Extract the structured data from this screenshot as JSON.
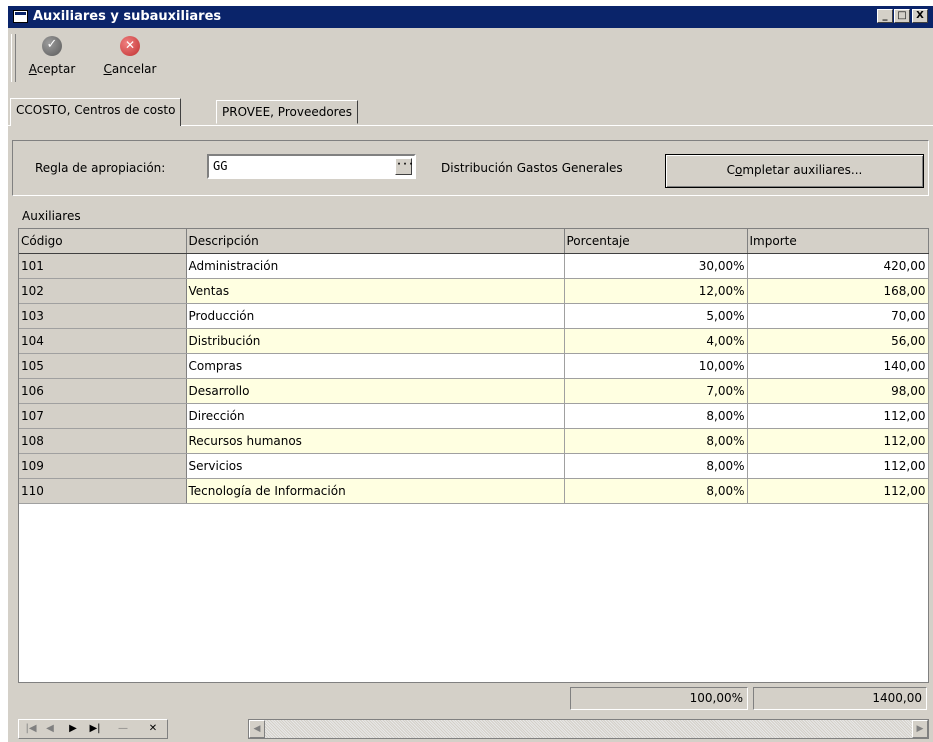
{
  "window": {
    "title": "Auxiliares y subauxiliares",
    "controls": [
      "_",
      "□",
      "X"
    ]
  },
  "toolbar": {
    "aceptar": {
      "prefix": "",
      "accel": "A",
      "rest": "ceptar",
      "icon": "check-circle-icon"
    },
    "cancelar": {
      "prefix": "",
      "accel": "C",
      "rest": "ancelar",
      "icon": "cancel-circle-icon"
    }
  },
  "tabs": [
    {
      "label": "CCOSTO, Centros de costo",
      "active": true
    },
    {
      "label": "PROVEE, Proveedores",
      "active": false
    }
  ],
  "form": {
    "regla_label": "Regla de apropiación:",
    "regla_value": "GG",
    "ellipsis": "···",
    "regla_desc": "Distribución Gastos Generales",
    "completar": {
      "prefix": "C",
      "accel": "o",
      "rest": "mpletar auxiliares..."
    }
  },
  "grid": {
    "section_label": "Auxiliares",
    "columns": [
      "Código",
      "Descripción",
      "Porcentaje",
      "Importe"
    ],
    "rows": [
      [
        "101",
        "Administración",
        "30,00%",
        "420,00"
      ],
      [
        "102",
        "Ventas",
        "12,00%",
        "168,00"
      ],
      [
        "103",
        "Producción",
        "5,00%",
        "70,00"
      ],
      [
        "104",
        "Distribución",
        "4,00%",
        "56,00"
      ],
      [
        "105",
        "Compras",
        "10,00%",
        "140,00"
      ],
      [
        "106",
        "Desarrollo",
        "7,00%",
        "98,00"
      ],
      [
        "107",
        "Dirección",
        "8,00%",
        "112,00"
      ],
      [
        "108",
        "Recursos humanos",
        "8,00%",
        "112,00"
      ],
      [
        "109",
        "Servicios",
        "8,00%",
        "112,00"
      ],
      [
        "110",
        "Tecnología de Información",
        "8,00%",
        "112,00"
      ]
    ],
    "totals": {
      "porcentaje": "100,00%",
      "importe": "1400,00"
    }
  },
  "navigator": {
    "first": "|◀",
    "prior": "◀",
    "next": "▶",
    "last": "▶|",
    "post": "—",
    "cancel": "✕"
  },
  "scroll": {
    "left": "◀",
    "right": "▶"
  },
  "colors": {
    "titlebar": "#0a246a",
    "face": "#d4d0c8",
    "alt_row": "#ffffe1"
  }
}
